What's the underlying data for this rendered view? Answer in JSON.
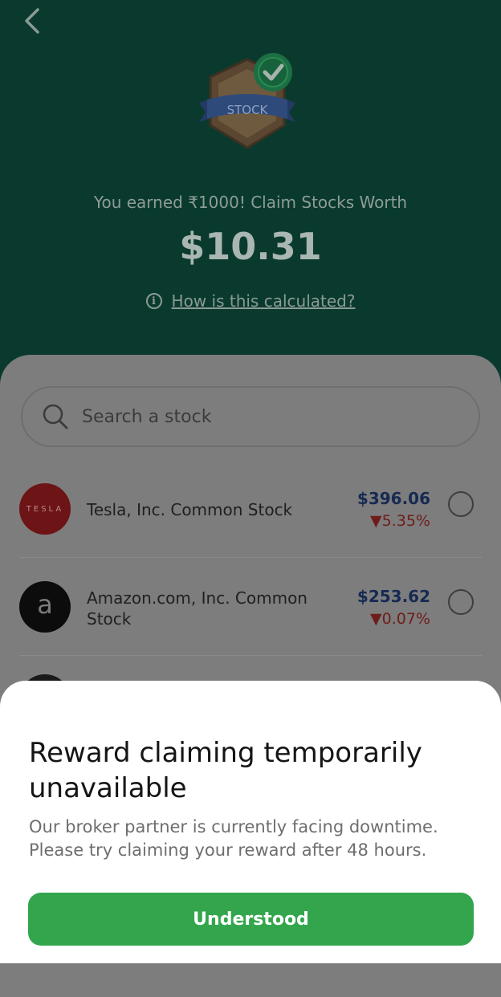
{
  "header": {
    "badge_label": "STOCK",
    "earned_text": "You earned ₹1000! Claim Stocks Worth",
    "amount": "$10.31",
    "how_calculated_link": "How is this calculated?"
  },
  "search": {
    "placeholder": "Search a stock"
  },
  "stocks": [
    {
      "logo_text": "TESLA",
      "name": "Tesla, Inc. Common Stock",
      "price": "$396.06",
      "change": "▼5.35%"
    },
    {
      "logo_text": "a",
      "name": "Amazon.com, Inc. Common Stock",
      "price": "$253.62",
      "change": "▼0.07%"
    }
  ],
  "modal": {
    "title": "Reward claiming temporarily unavailable",
    "body": "Our broker partner is currently facing downtime. Please try claiming your reward after 48 hours.",
    "button_label": "Understood"
  },
  "colors": {
    "header_bg": "#0a3a2e",
    "overlay_gray": "#7d7d7d",
    "button_green": "#33a64d",
    "tesla_red": "#6d1416",
    "change_red": "#6e1d1a"
  }
}
